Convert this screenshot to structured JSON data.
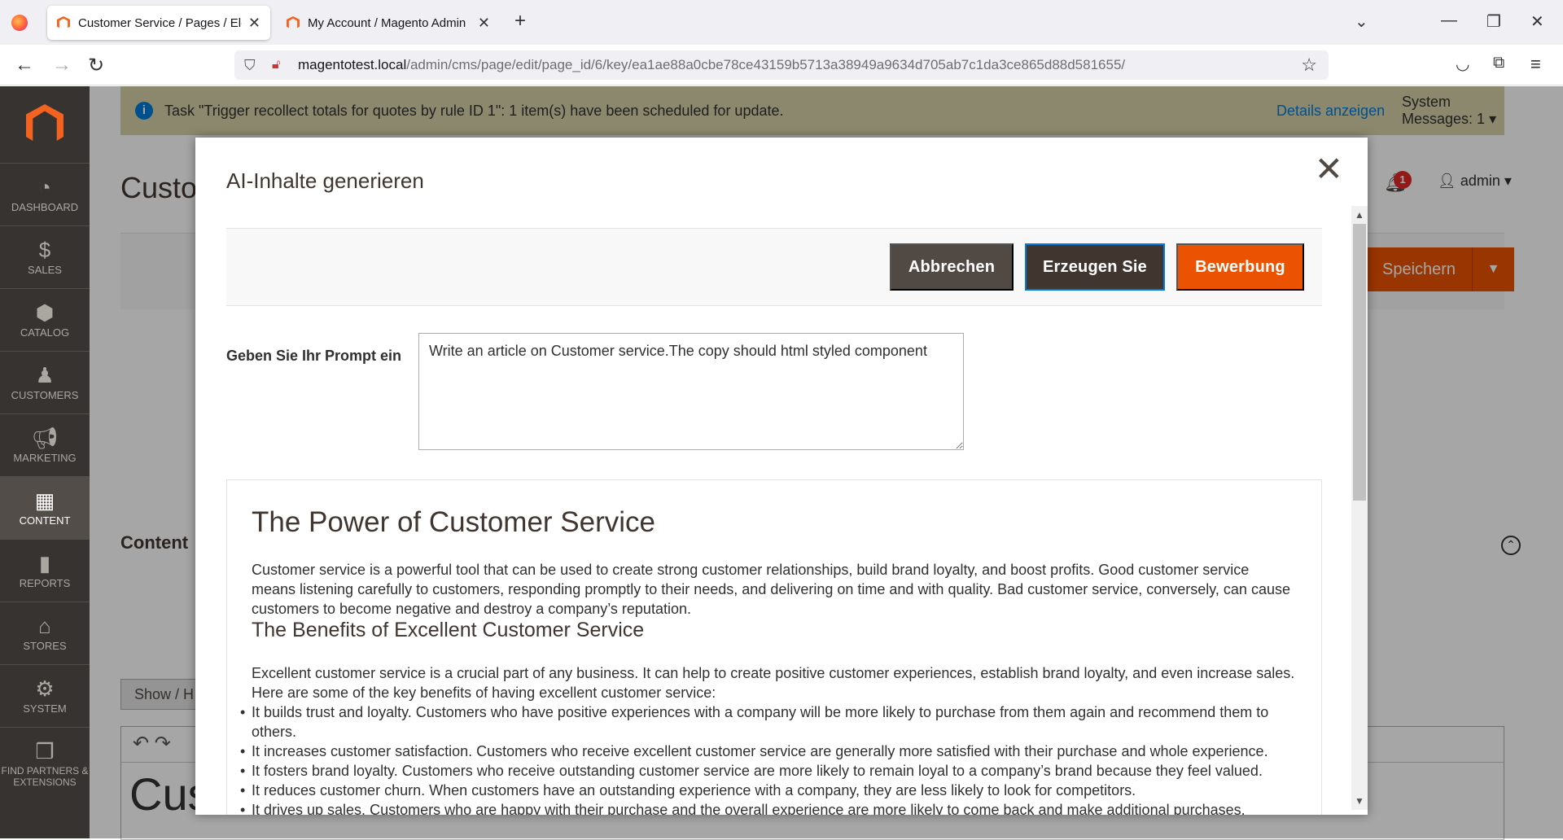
{
  "browser": {
    "tabs": [
      {
        "title": "Customer Service / Pages / Elements",
        "active": true
      },
      {
        "title": "My Account / Magento Admin",
        "active": false
      }
    ],
    "url_host": "magentotest.local",
    "url_path": "/admin/cms/page/edit/page_id/6/key/ea1ae88a0cbe78ce43159b5713a38949a9634d705ab7c1da3ce865d88d581655/"
  },
  "sidebar": {
    "items": [
      {
        "label": "DASHBOARD",
        "icon": "dashboard-icon"
      },
      {
        "label": "SALES",
        "icon": "dollar-icon"
      },
      {
        "label": "CATALOG",
        "icon": "cube-icon"
      },
      {
        "label": "CUSTOMERS",
        "icon": "person-icon"
      },
      {
        "label": "MARKETING",
        "icon": "megaphone-icon"
      },
      {
        "label": "CONTENT",
        "icon": "layout-icon",
        "active": true
      },
      {
        "label": "REPORTS",
        "icon": "bar-chart-icon"
      },
      {
        "label": "STORES",
        "icon": "store-icon"
      },
      {
        "label": "SYSTEM",
        "icon": "gear-icon"
      },
      {
        "label": "FIND PARTNERS & EXTENSIONS",
        "icon": "boxes-icon"
      }
    ]
  },
  "notice": {
    "text": "Task \"Trigger recollect totals for quotes by rule ID 1\": 1 item(s) have been scheduled for update.",
    "details_link": "Details anzeigen",
    "system_messages": "System Messages: 1"
  },
  "page": {
    "title": "Custo",
    "notification_count": "1",
    "user": "admin",
    "save_label": "Speichern",
    "content_heading": "Content",
    "show_hide_label": "Show / H",
    "editor_preview": "Cus"
  },
  "modal": {
    "title": "AI-Inhalte generieren",
    "cancel_label": "Abbrechen",
    "generate_label": "Erzeugen Sie",
    "apply_label": "Bewerbung",
    "prompt_label": "Geben Sie Ihr Prompt ein",
    "prompt_value": "Write an article on Customer service.The copy should html styled component",
    "result": {
      "h1": "The Power of Customer Service",
      "p1": "Customer service is a powerful tool that can be used to create strong customer relationships, build brand loyalty, and boost profits. Good customer service means listening carefully to customers, responding promptly to their needs, and delivering on time and with quality. Bad customer service, conversely, can cause customers to become negative and destroy a company’s reputation.",
      "h2": "The Benefits of Excellent Customer Service",
      "p2": "Excellent customer service is a crucial part of any business. It can help to create positive customer experiences, establish brand loyalty, and even increase sales. Here are some of the key benefits of having excellent customer service:",
      "list": [
        "It builds trust and loyalty. Customers who have positive experiences with a company will be more likely to purchase from them again and recommend them to others.",
        "It increases customer satisfaction. Customers who receive excellent customer service are generally more satisfied with their purchase and whole experience.",
        "It fosters brand loyalty. Customers who receive outstanding customer service are more likely to remain loyal to a company’s brand because they feel valued.",
        "It reduces customer churn. When customers have an outstanding experience with a company, they are less likely to look for competitors.",
        "It drives up sales. Customers who are happy with their purchase and the overall experience are more likely to come back and make additional purchases."
      ]
    }
  },
  "colors": {
    "accent_orange": "#eb5202",
    "sidebar_bg": "#373330",
    "link_blue": "#007bdb"
  }
}
